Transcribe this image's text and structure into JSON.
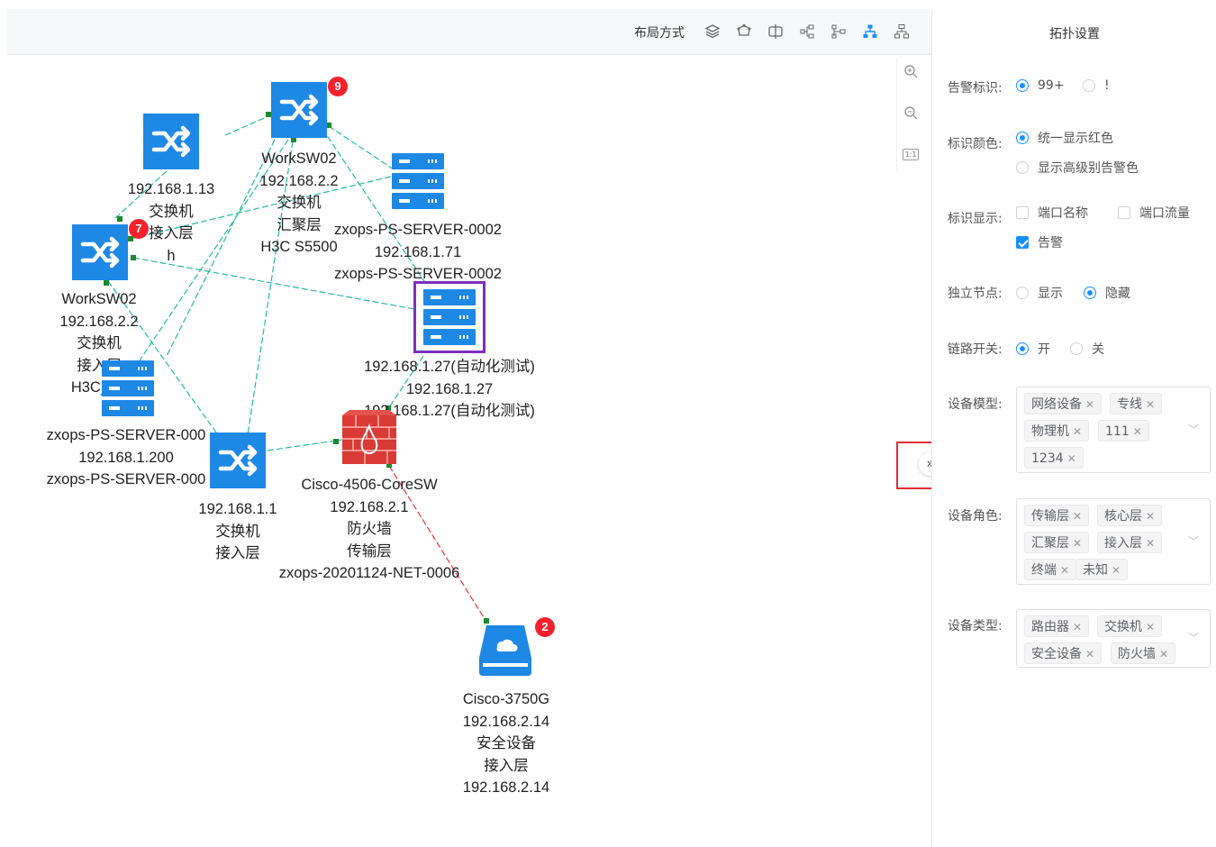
{
  "toolbar": {
    "layout_label": "布局方式",
    "icons": [
      "layers-icon",
      "circular-layout-icon",
      "split-layout-icon",
      "tree-left-icon",
      "tree-right-icon",
      "hierarchy-icon",
      "tree-down-icon"
    ],
    "active_index": 5
  },
  "zoom": {
    "in_icon": "zoom-in-icon",
    "out_icon": "zoom-out-icon",
    "fit_label": "1:1"
  },
  "nodes": {
    "sw_top": {
      "label": [
        "WorkSW02",
        "192.168.2.2",
        "交换机",
        "汇聚层",
        "H3C S5500"
      ],
      "alarms": "9"
    },
    "sw_mid": {
      "label": [
        "192.168.1.13",
        "交换机",
        "接入层",
        "h"
      ]
    },
    "sw_left": {
      "label": [
        "WorkSW02",
        "192.168.2.2",
        "交换机",
        "接入层",
        "H3C_S5"
      ],
      "alarms": "7"
    },
    "server_top": {
      "label": [
        "zxops-PS-SERVER-0002",
        "192.168.1.71",
        "zxops-PS-SERVER-0002"
      ]
    },
    "server_sel": {
      "label": [
        "192.168.1.27(自动化测试)",
        "192.168.1.27",
        "192.168.1.27(自动化测试)"
      ]
    },
    "server_left": {
      "label": [
        "zxops-PS-SERVER-000",
        "192.168.1.200",
        "zxops-PS-SERVER-000"
      ]
    },
    "sw_bottom": {
      "label": [
        "192.168.1.1",
        "交换机",
        "接入层"
      ]
    },
    "firewall": {
      "label": [
        "Cisco-4506-CoreSW",
        "192.168.2.1",
        "防火墙",
        "传输层",
        "zxops-20201124-NET-0006"
      ]
    },
    "storage": {
      "label": [
        "Cisco-3750G",
        "192.168.2.14",
        "安全设备",
        "接入层",
        "192.168.2.14"
      ],
      "alarms": "2"
    }
  },
  "colors": {
    "accent": "#1890ff",
    "device_blue": "#1e88e5",
    "alarm_red": "#f5222d",
    "link": "#26b9a4",
    "selected": "#7b2fbe"
  },
  "sidebar": {
    "title": "拓扑设置",
    "alarm_mark": {
      "label": "告警标识:",
      "options": [
        "99+",
        "!"
      ],
      "selected": 0
    },
    "mark_color": {
      "label": "标识颜色:",
      "options": [
        "统一显示红色",
        "显示高级别告警色"
      ],
      "selected": 0
    },
    "mark_display": {
      "label": "标识显示:",
      "options": [
        "端口名称",
        "端口流量",
        "告警"
      ],
      "checked": [
        false,
        false,
        true
      ]
    },
    "isolated": {
      "label": "独立节点:",
      "options": [
        "显示",
        "隐藏"
      ],
      "selected": 1
    },
    "link_switch": {
      "label": "链路开关:",
      "options": [
        "开",
        "关"
      ],
      "selected": 0
    },
    "device_model": {
      "label": "设备模型:",
      "tags": [
        "网络设备",
        "专线",
        "物理机",
        "111",
        "1234"
      ]
    },
    "device_role": {
      "label": "设备角色:",
      "tags": [
        "传输层",
        "核心层",
        "汇聚层",
        "接入层",
        "终端",
        "未知"
      ]
    },
    "device_type": {
      "label": "设备类型:",
      "tags": [
        "路由器",
        "交换机",
        "安全设备",
        "防火墙"
      ]
    }
  },
  "collapse_label": "»"
}
